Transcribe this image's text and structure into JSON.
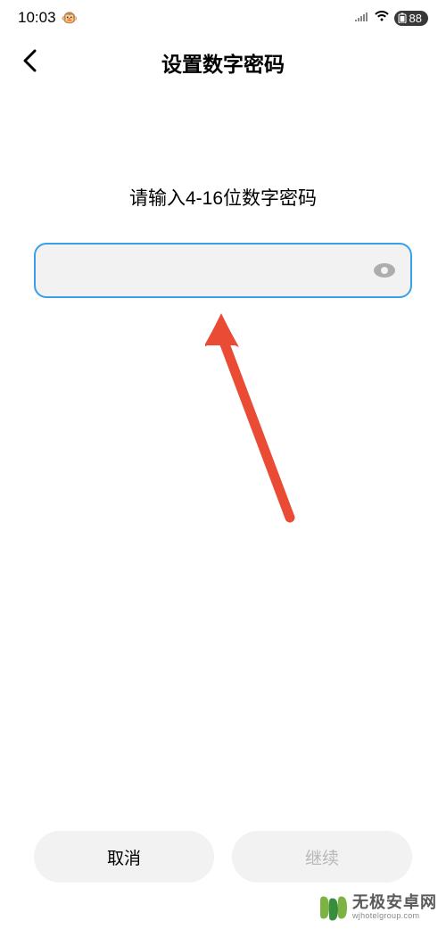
{
  "statusBar": {
    "time": "10:03",
    "emoji": "🐵",
    "battery": "88"
  },
  "nav": {
    "title": "设置数字密码"
  },
  "content": {
    "prompt": "请输入4-16位数字密码"
  },
  "buttons": {
    "cancel": "取消",
    "continue": "继续"
  },
  "watermark": {
    "title": "无极安卓网",
    "url": "wjhotelgroup.com"
  }
}
